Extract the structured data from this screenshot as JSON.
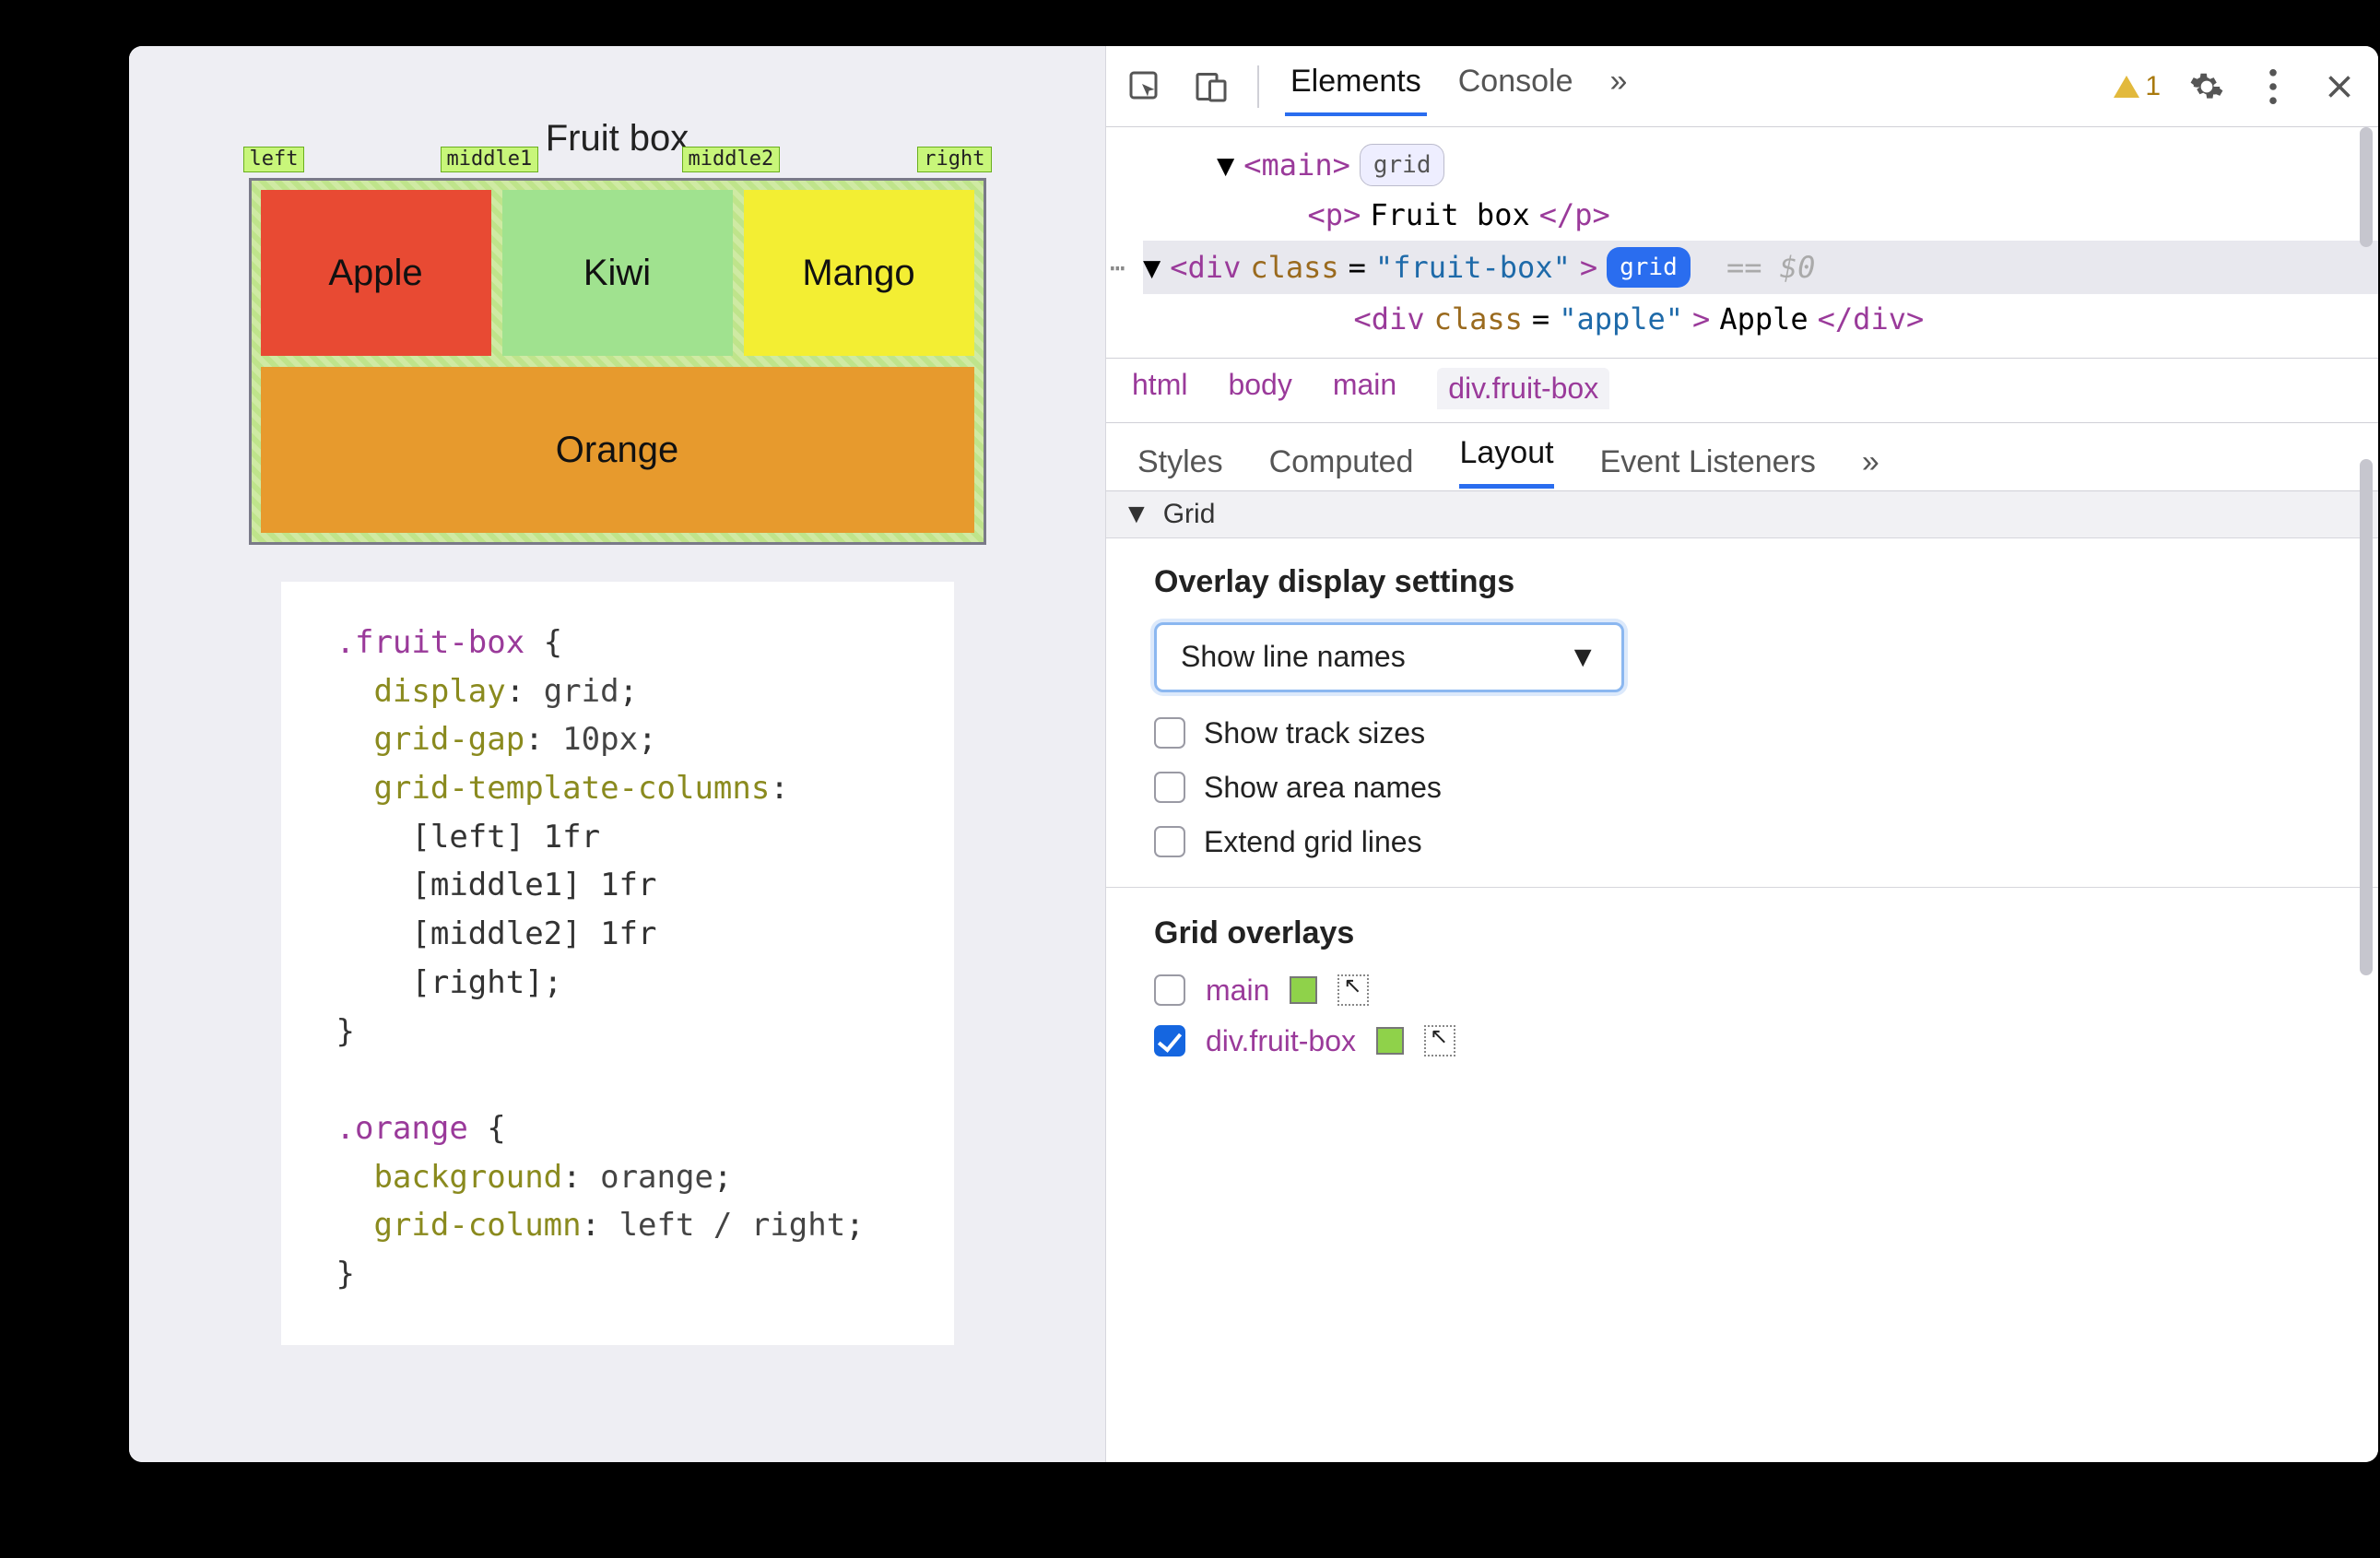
{
  "page": {
    "title": "Fruit box",
    "lineNames": [
      "left",
      "middle1",
      "middle2",
      "right"
    ],
    "cells": {
      "apple": "Apple",
      "kiwi": "Kiwi",
      "mango": "Mango",
      "orange": "Orange"
    },
    "css": ".fruit-box {\n  display: grid;\n  grid-gap: 10px;\n  grid-template-columns:\n    [left] 1fr\n    [middle1] 1fr\n    [middle2] 1fr\n    [right];\n}\n\n.orange {\n  background: orange;\n  grid-column: left / right;\n}"
  },
  "devtools": {
    "tabs": {
      "elements": "Elements",
      "console": "Console",
      "more": "»"
    },
    "warningCount": "1",
    "dom": {
      "mainBadge": "grid",
      "pText": "Fruit box",
      "fruitBoxClass": "fruit-box",
      "fruitBoxBadge": "grid",
      "eqZero": "== $0",
      "appleClass": "apple",
      "appleText": "Apple"
    },
    "crumbs": [
      "html",
      "body",
      "main",
      "div.fruit-box"
    ],
    "subtabs": {
      "styles": "Styles",
      "computed": "Computed",
      "layout": "Layout",
      "events": "Event Listeners",
      "more": "»"
    },
    "grid": {
      "header": "Grid",
      "overlayTitle": "Overlay display settings",
      "selectLabel": "Show line names",
      "opts": {
        "trackSizes": "Show track sizes",
        "areaNames": "Show area names",
        "extend": "Extend grid lines"
      },
      "overlaysTitle": "Grid overlays",
      "overlays": [
        {
          "name": "main",
          "checked": false
        },
        {
          "name": "div.fruit-box",
          "checked": true
        }
      ]
    }
  }
}
